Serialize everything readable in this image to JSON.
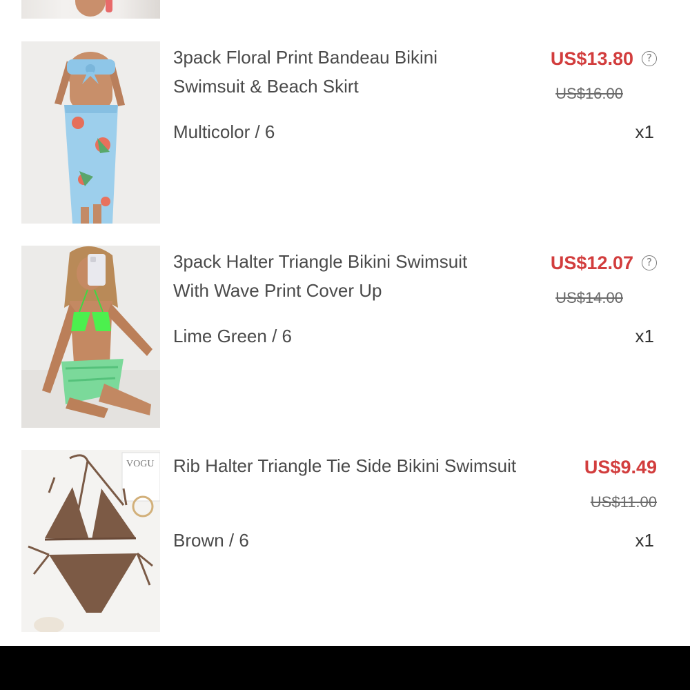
{
  "items": [
    {
      "title_line1": "3pack Floral Print Bandeau Bikini",
      "title_line2": "Swimsuit & Beach Skirt",
      "price": "US$13.80",
      "original_price": "US$16.00",
      "variant": "Multicolor / 6",
      "quantity": "x1",
      "help_icon": "?"
    },
    {
      "title_line1": "3pack Halter Triangle Bikini Swimsuit",
      "title_line2": "With Wave Print Cover Up",
      "price": "US$12.07",
      "original_price": "US$14.00",
      "variant": "Lime Green / 6",
      "quantity": "x1",
      "help_icon": "?"
    },
    {
      "title_line1": "Rib Halter Triangle Tie Side Bikini Swimsuit",
      "title_line2": "",
      "price": "US$9.49",
      "original_price": "US$11.00",
      "variant": "Brown / 6",
      "quantity": "x1"
    }
  ],
  "colors": {
    "price": "#d23d3d",
    "text": "#4a4a4a",
    "strikethrough": "#6a6a6a"
  }
}
